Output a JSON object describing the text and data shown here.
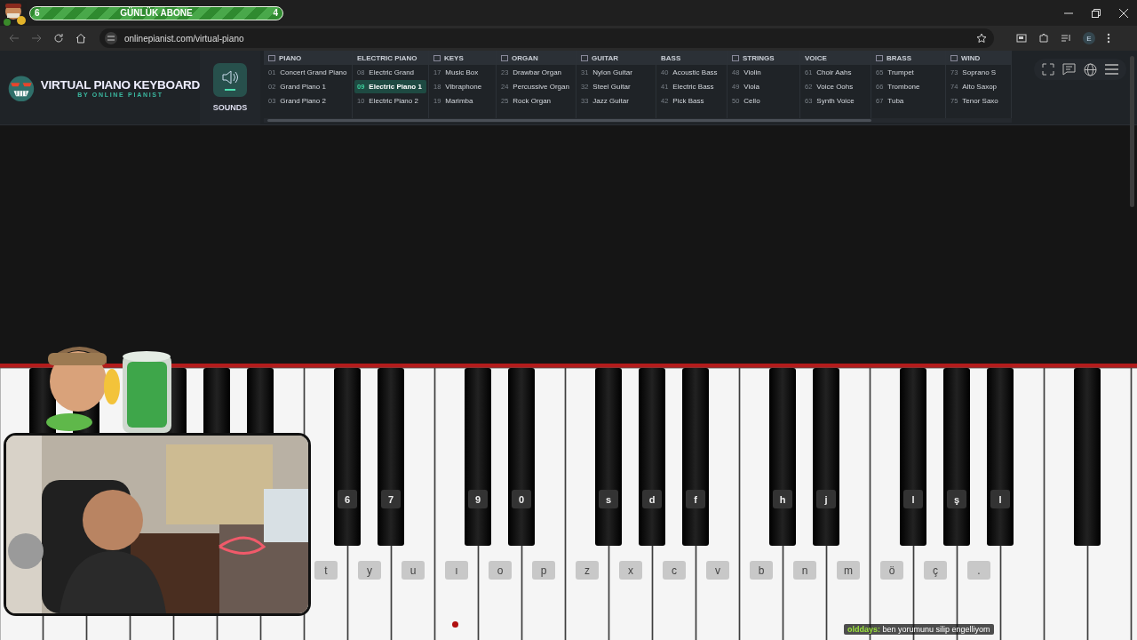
{
  "stream_overlay": {
    "left_count": "6",
    "goal_label": "GÜNLÜK ABONE",
    "right_count": "4"
  },
  "browser": {
    "url": "onlinepianist.com/virtual-piano",
    "profile_letter": "E"
  },
  "site": {
    "logo_title": "VIRTUAL PIANO KEYBOARD",
    "logo_subtitle": "BY ONLINE PIANIST",
    "sounds_label": "SOUNDS"
  },
  "categories": [
    {
      "name": "PIANO",
      "has_icon": true,
      "items": [
        {
          "number": "01",
          "name": "Concert Grand Piano",
          "selected": false
        },
        {
          "number": "02",
          "name": "Grand Piano 1",
          "selected": false
        },
        {
          "number": "03",
          "name": "Grand Piano 2",
          "selected": false
        }
      ]
    },
    {
      "name": "ELECTRIC PIANO",
      "has_icon": false,
      "items": [
        {
          "number": "08",
          "name": "Electric Grand",
          "selected": false
        },
        {
          "number": "09",
          "name": "Electric Piano 1",
          "selected": true
        },
        {
          "number": "10",
          "name": "Electric Piano 2",
          "selected": false
        }
      ]
    },
    {
      "name": "KEYS",
      "has_icon": true,
      "items": [
        {
          "number": "17",
          "name": "Music Box",
          "selected": false
        },
        {
          "number": "18",
          "name": "Vibraphone",
          "selected": false
        },
        {
          "number": "19",
          "name": "Marimba",
          "selected": false
        }
      ]
    },
    {
      "name": "ORGAN",
      "has_icon": true,
      "items": [
        {
          "number": "23",
          "name": "Drawbar Organ",
          "selected": false
        },
        {
          "number": "24",
          "name": "Percussive Organ",
          "selected": false
        },
        {
          "number": "25",
          "name": "Rock Organ",
          "selected": false
        }
      ]
    },
    {
      "name": "GUITAR",
      "has_icon": true,
      "items": [
        {
          "number": "31",
          "name": "Nylon Guitar",
          "selected": false
        },
        {
          "number": "32",
          "name": "Steel Guitar",
          "selected": false
        },
        {
          "number": "33",
          "name": "Jazz Guitar",
          "selected": false
        }
      ]
    },
    {
      "name": "BASS",
      "has_icon": false,
      "items": [
        {
          "number": "40",
          "name": "Acoustic Bass",
          "selected": false
        },
        {
          "number": "41",
          "name": "Electric Bass",
          "selected": false
        },
        {
          "number": "42",
          "name": "Pick Bass",
          "selected": false
        }
      ]
    },
    {
      "name": "STRINGS",
      "has_icon": true,
      "items": [
        {
          "number": "48",
          "name": "Violin",
          "selected": false
        },
        {
          "number": "49",
          "name": "Viola",
          "selected": false
        },
        {
          "number": "50",
          "name": "Cello",
          "selected": false
        }
      ]
    },
    {
      "name": "VOICE",
      "has_icon": false,
      "items": [
        {
          "number": "61",
          "name": "Choir Aahs",
          "selected": false
        },
        {
          "number": "62",
          "name": "Voice Oohs",
          "selected": false
        },
        {
          "number": "63",
          "name": "Synth Voice",
          "selected": false
        }
      ]
    },
    {
      "name": "BRASS",
      "has_icon": true,
      "items": [
        {
          "number": "65",
          "name": "Trumpet",
          "selected": false
        },
        {
          "number": "66",
          "name": "Trombone",
          "selected": false
        },
        {
          "number": "67",
          "name": "Tuba",
          "selected": false
        }
      ]
    },
    {
      "name": "WIND",
      "has_icon": true,
      "items": [
        {
          "number": "73",
          "name": "Soprano S",
          "selected": false
        },
        {
          "number": "74",
          "name": "Alto Saxop",
          "selected": false
        },
        {
          "number": "75",
          "name": "Tenor Saxo",
          "selected": false
        }
      ]
    }
  ],
  "piano": {
    "white_key_labels": [
      "t",
      "y",
      "u",
      "ı",
      "o",
      "p",
      "z",
      "x",
      "c",
      "v",
      "b",
      "n",
      "m",
      "ö",
      "ç",
      "."
    ],
    "black_key_labels": [
      "6",
      "7",
      "9",
      "0",
      "s",
      "d",
      "f",
      "h",
      "j",
      "l",
      "ş",
      "l"
    ]
  },
  "chat": {
    "user": "olddays:",
    "message": "ben yorumunu silip engelliyom"
  }
}
